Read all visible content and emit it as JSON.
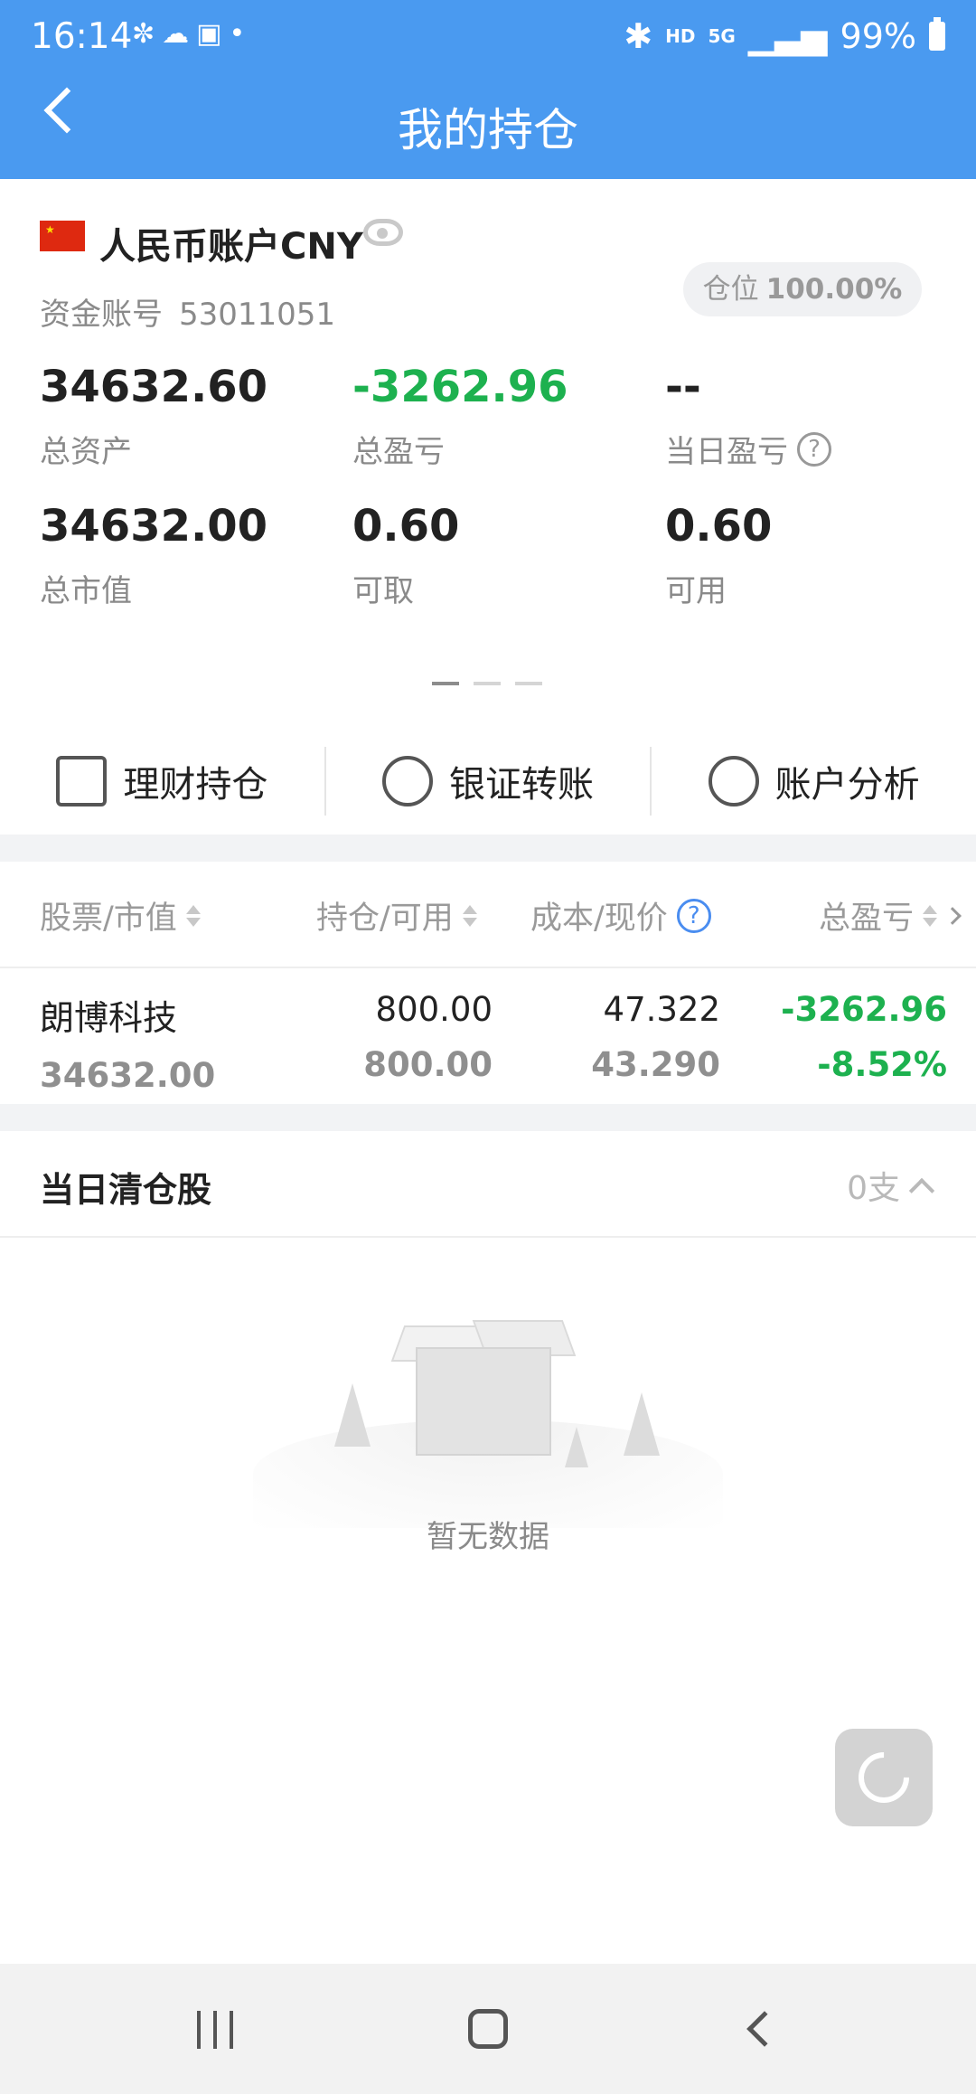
{
  "status_bar": {
    "time": "16:14",
    "left_icons": [
      "network-icon",
      "cloud-icon",
      "image-icon",
      "dot-icon"
    ],
    "right_icons": [
      "bluetooth-icon",
      "hd-icon",
      "5g-icon",
      "signal-icon",
      "battery-icon"
    ],
    "hd": "HD",
    "network": "5G",
    "battery": "99%"
  },
  "header": {
    "title": "我的持仓"
  },
  "account": {
    "name": "人民币账户CNY",
    "account_label": "资金账号",
    "account_number": "53011051",
    "position_label": "仓位",
    "position_value": "100.00%"
  },
  "metrics": {
    "total_assets": {
      "value": "34632.60",
      "label": "总资产"
    },
    "total_pl": {
      "value": "-3262.96",
      "label": "总盈亏"
    },
    "daily_pl": {
      "value": "--",
      "label": "当日盈亏"
    },
    "market_value": {
      "value": "34632.00",
      "label": "总市值"
    },
    "withdrawable": {
      "value": "0.60",
      "label": "可取"
    },
    "available": {
      "value": "0.60",
      "label": "可用"
    }
  },
  "quick_actions": [
    {
      "label": "理财持仓",
      "icon": "house-chart-icon"
    },
    {
      "label": "银证转账",
      "icon": "transfer-icon"
    },
    {
      "label": "账户分析",
      "icon": "pie-chart-icon"
    }
  ],
  "table": {
    "headers": [
      "股票/市值",
      "持仓/可用",
      "成本/现价",
      "总盈亏"
    ],
    "rows": [
      {
        "name": "朗博科技",
        "market_value": "34632.00",
        "holding": "800.00",
        "available": "800.00",
        "cost": "47.322",
        "price": "43.290",
        "pl": "-3262.96",
        "pl_pct": "-8.52%"
      }
    ]
  },
  "cleared": {
    "title": "当日清仓股",
    "count": "0支"
  },
  "empty_text": "暂无数据",
  "colors": {
    "header": "#4a9af0",
    "loss": "#1db14f",
    "accent": "#4a8df0"
  }
}
